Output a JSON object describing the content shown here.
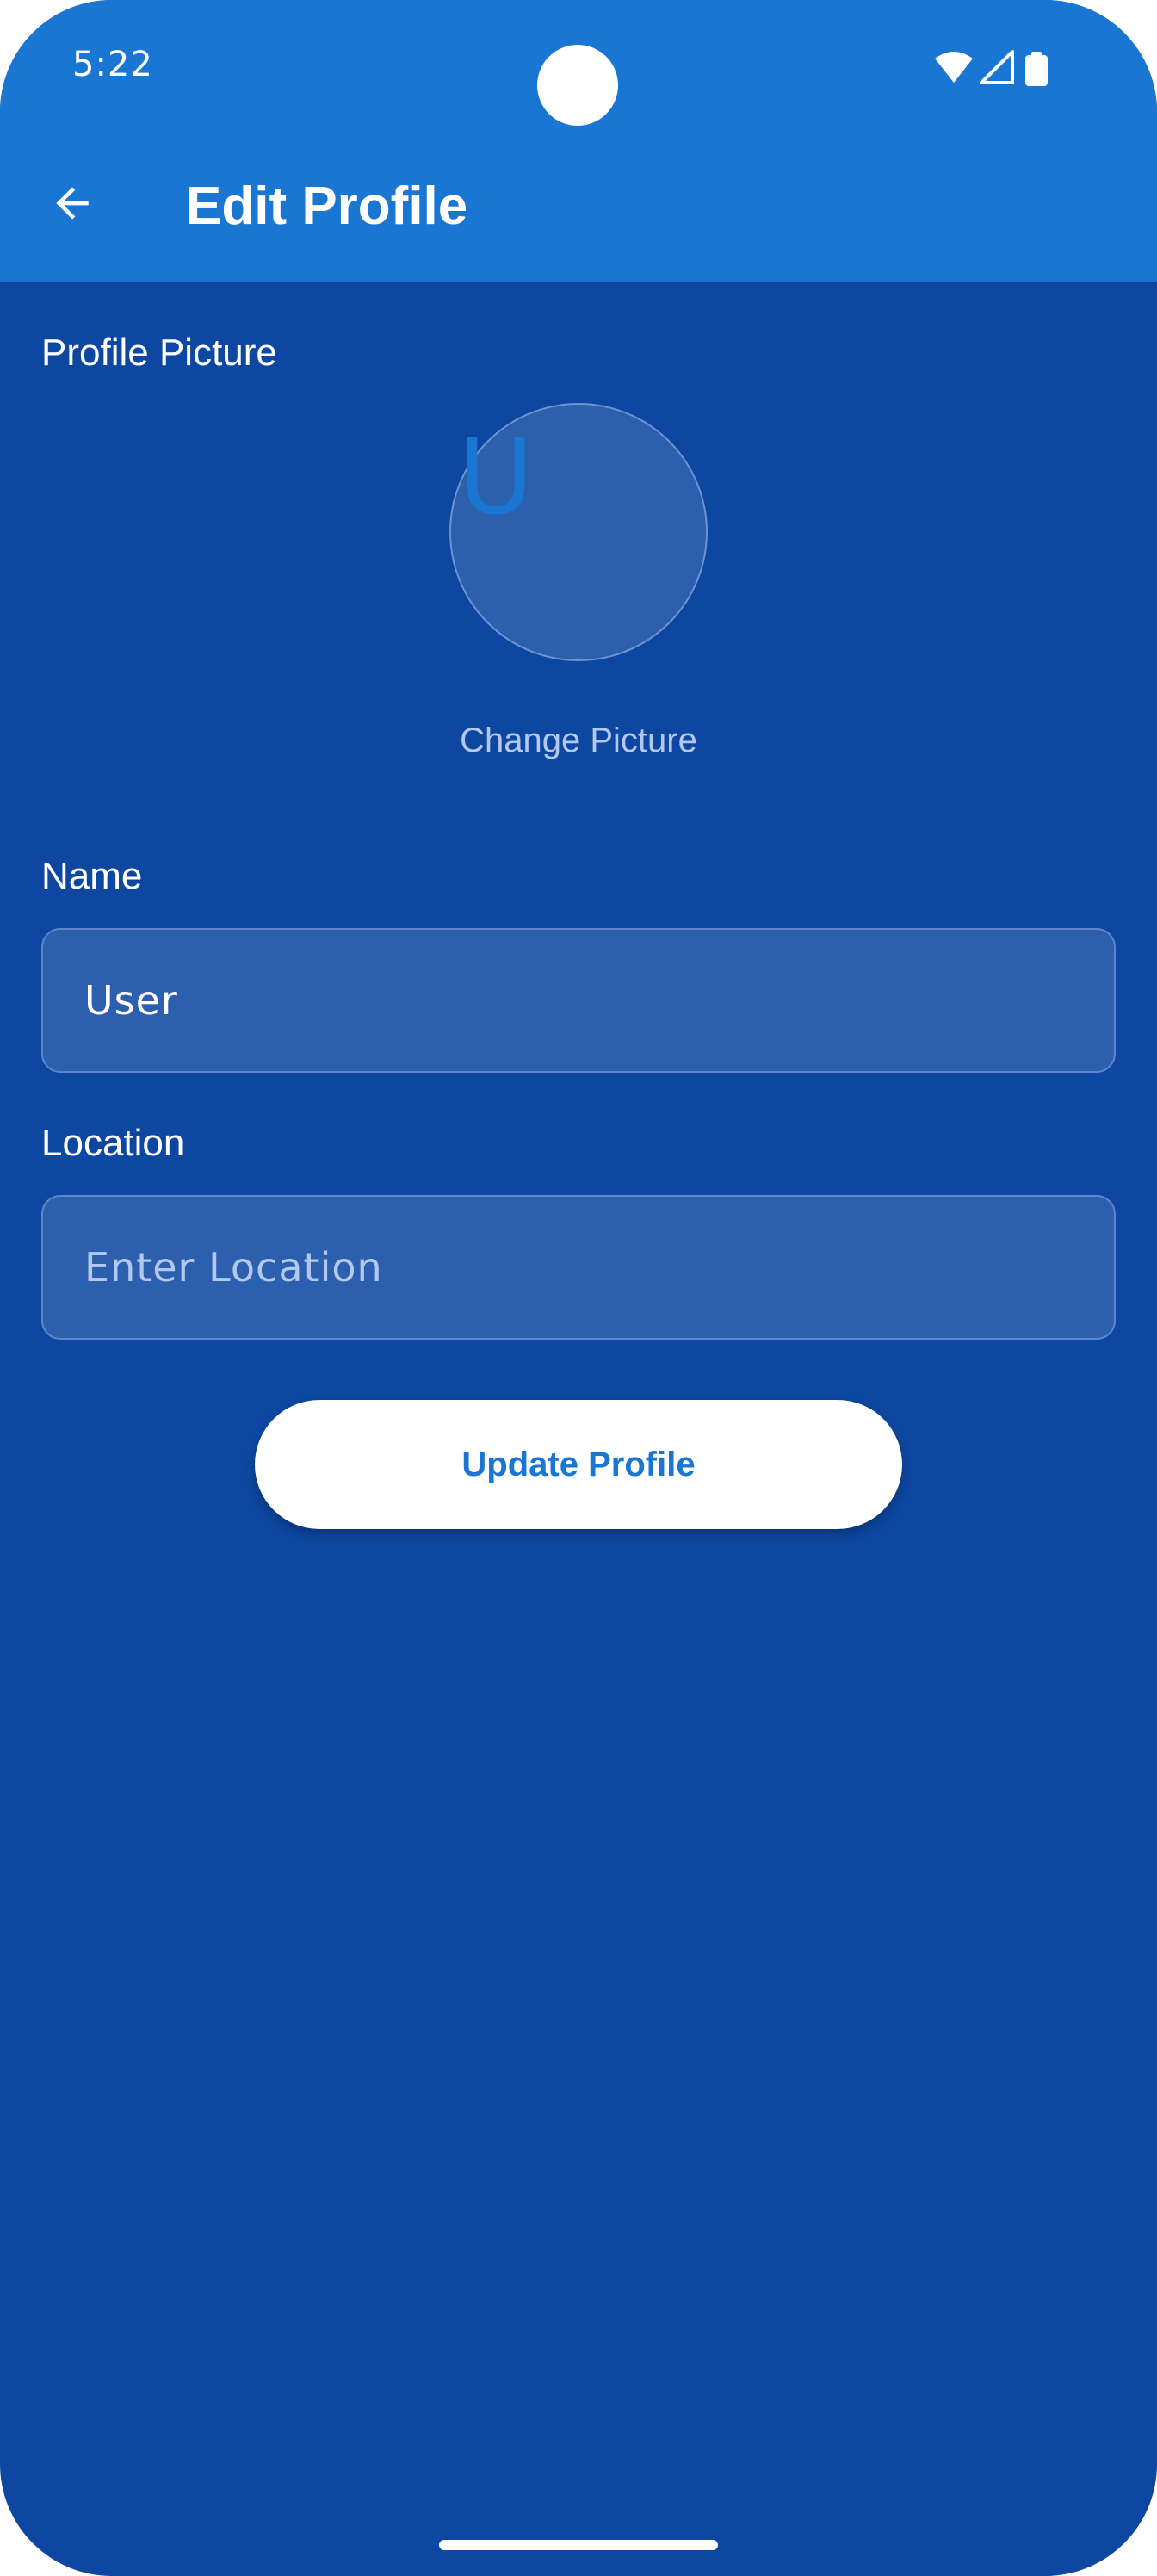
{
  "status_bar": {
    "time": "5:22",
    "icons": [
      "wifi-icon",
      "signal-icon",
      "battery-icon"
    ]
  },
  "app_bar": {
    "back_icon": "arrow-left-icon",
    "title": "Edit Profile"
  },
  "profile_picture": {
    "label": "Profile Picture",
    "avatar_initial": "U",
    "change_label": "Change Picture"
  },
  "name": {
    "label": "Name",
    "value": "User",
    "placeholder": ""
  },
  "location": {
    "label": "Location",
    "value": "",
    "placeholder": "Enter Location"
  },
  "update_button": {
    "label": "Update Profile"
  },
  "colors": {
    "app_bar": "#1976d2",
    "background": "#0d47a1",
    "field_fill": "#2c5fad",
    "button_text": "#1976d2"
  }
}
